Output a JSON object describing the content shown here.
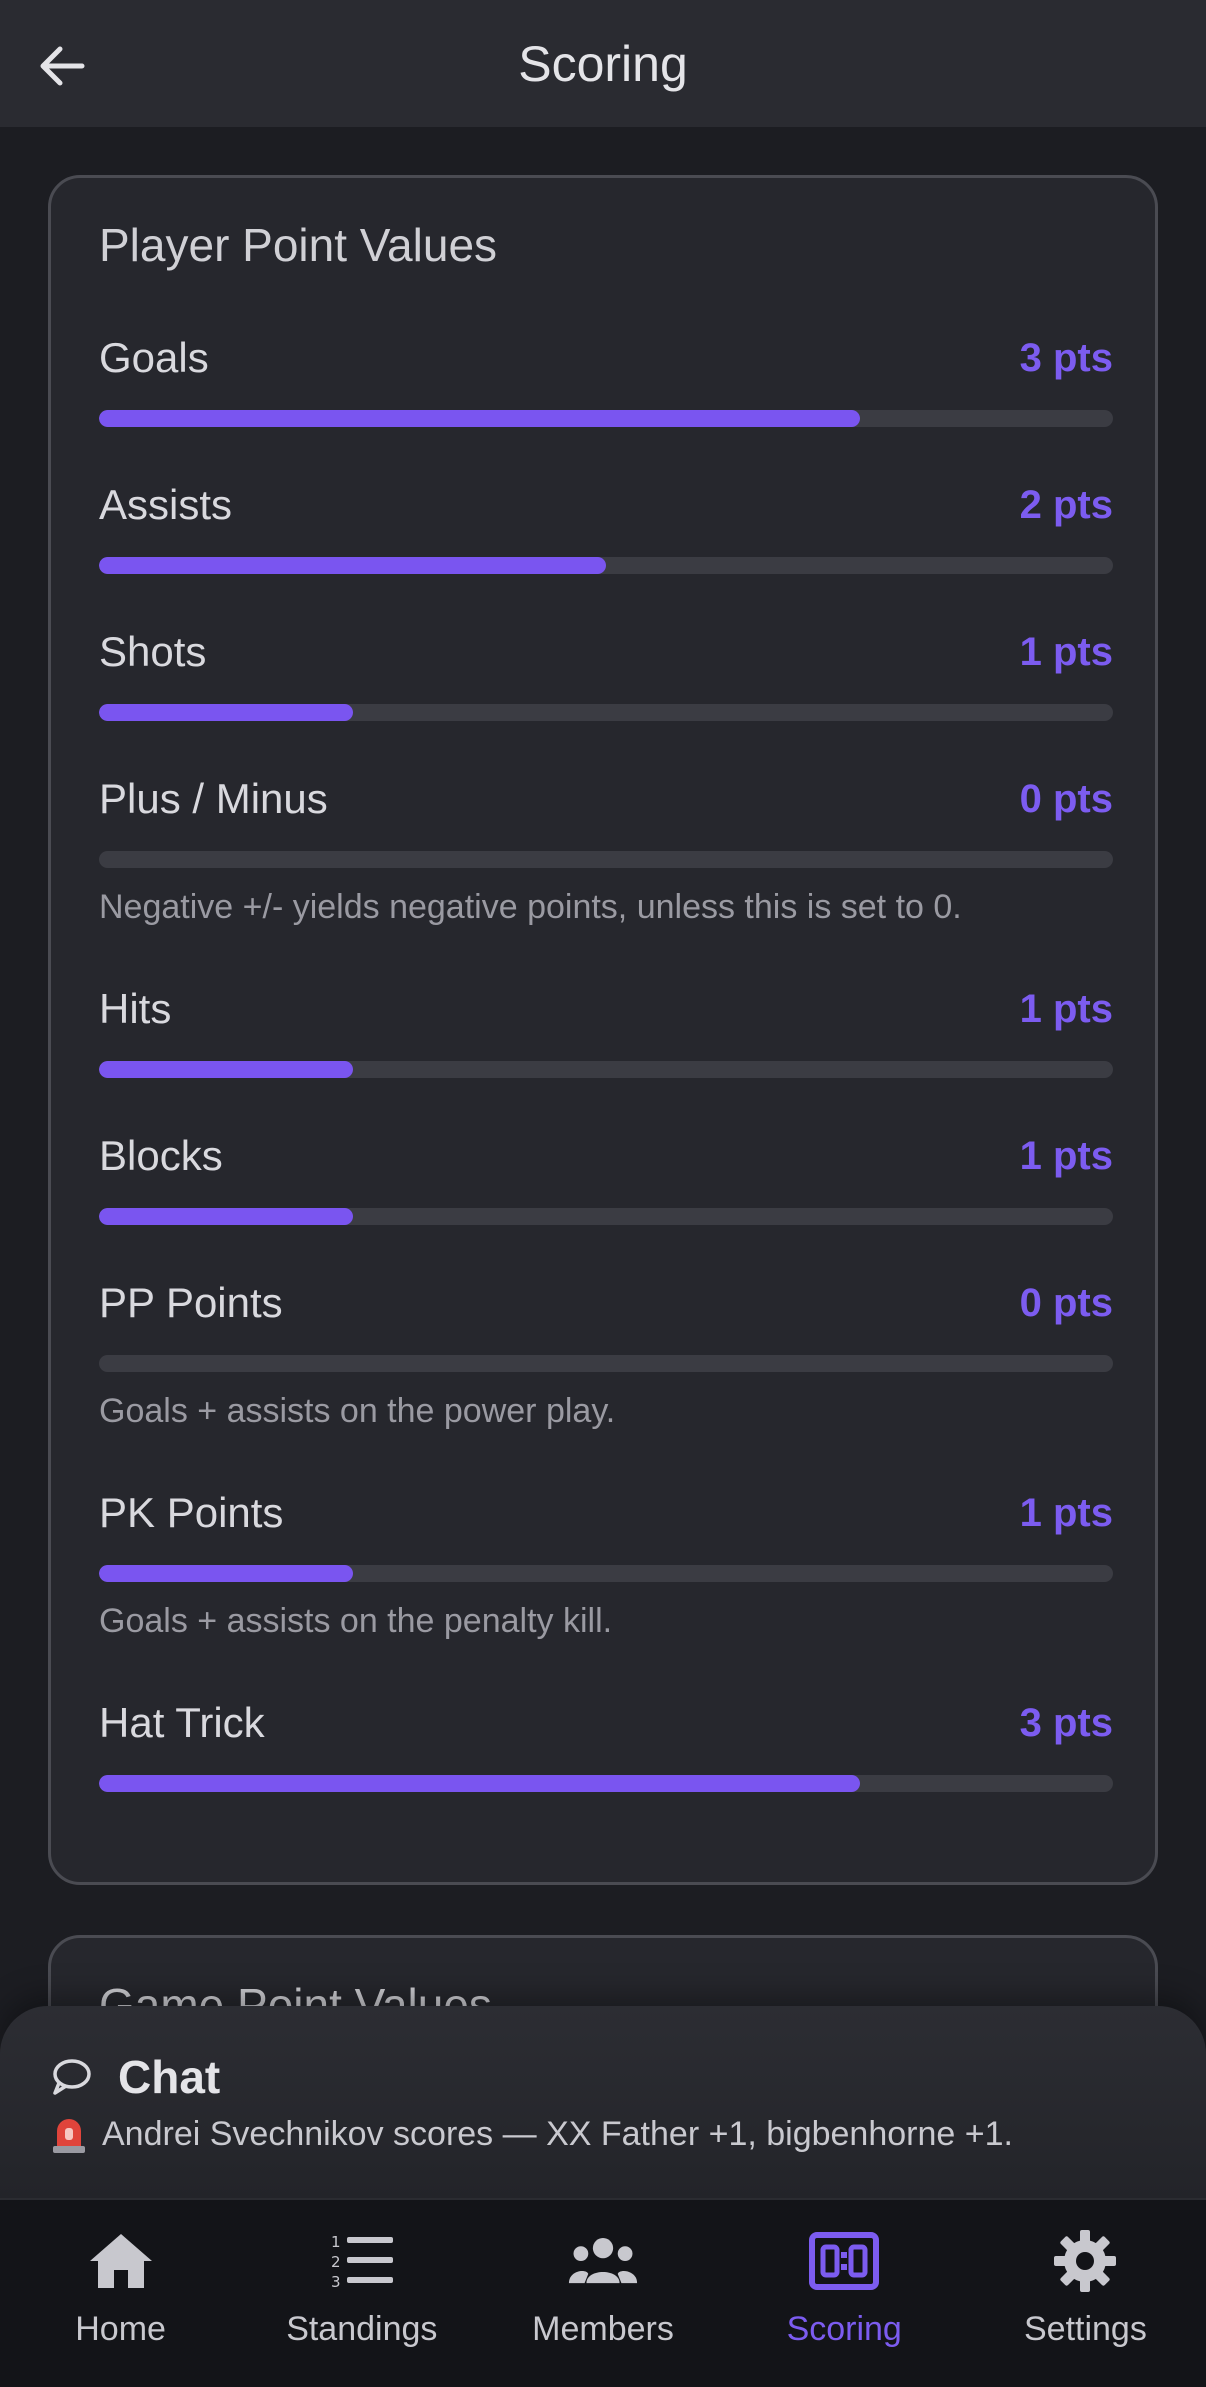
{
  "header": {
    "title": "Scoring"
  },
  "player_card": {
    "title": "Player Point Values",
    "max_points": 4,
    "stats": [
      {
        "label": "Goals",
        "points_label": "3 pts",
        "points": 3,
        "note": ""
      },
      {
        "label": "Assists",
        "points_label": "2 pts",
        "points": 2,
        "note": ""
      },
      {
        "label": "Shots",
        "points_label": "1 pts",
        "points": 1,
        "note": ""
      },
      {
        "label": "Plus / Minus",
        "points_label": "0 pts",
        "points": 0,
        "note": "Negative +/- yields negative points, unless this is set to 0."
      },
      {
        "label": "Hits",
        "points_label": "1 pts",
        "points": 1,
        "note": ""
      },
      {
        "label": "Blocks",
        "points_label": "1 pts",
        "points": 1,
        "note": ""
      },
      {
        "label": "PP Points",
        "points_label": "0 pts",
        "points": 0,
        "note": "Goals + assists on the power play."
      },
      {
        "label": "PK Points",
        "points_label": "1 pts",
        "points": 1,
        "note": "Goals + assists on the penalty kill."
      },
      {
        "label": "Hat Trick",
        "points_label": "3 pts",
        "points": 3,
        "note": ""
      }
    ]
  },
  "game_card": {
    "title": "Game Point Values"
  },
  "chat": {
    "title": "Chat",
    "last_message": "Andrei Svechnikov scores — XX Father +1, bigbenhorne +1."
  },
  "nav": {
    "items": [
      {
        "label": "Home",
        "icon": "home-icon",
        "active": false
      },
      {
        "label": "Standings",
        "icon": "list-numbered-icon",
        "active": false
      },
      {
        "label": "Members",
        "icon": "people-icon",
        "active": false
      },
      {
        "label": "Scoring",
        "icon": "scoreboard-icon",
        "active": true
      },
      {
        "label": "Settings",
        "icon": "gear-icon",
        "active": false
      }
    ]
  },
  "colors": {
    "accent": "#7c5cf0",
    "background": "#1c1d22",
    "card": "#26272d",
    "track": "#3b3c43"
  }
}
